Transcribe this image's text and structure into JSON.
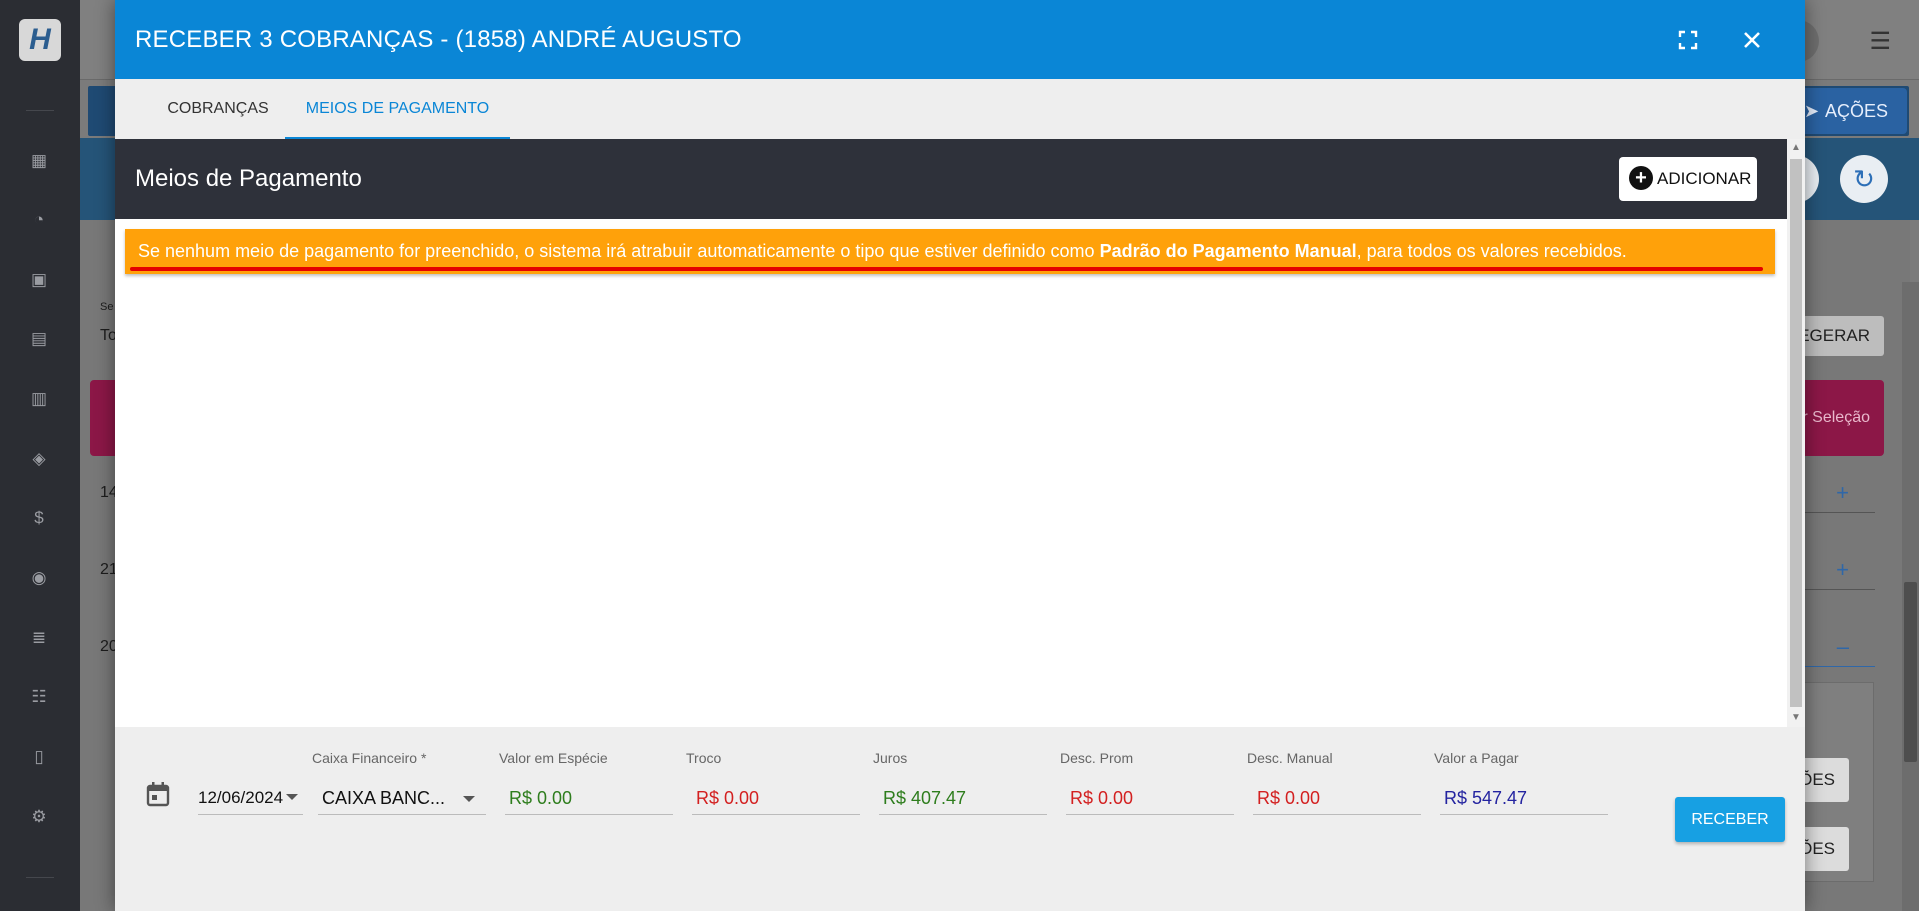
{
  "modal": {
    "title": "RECEBER 3 COBRANÇAS - (1858) ANDRÉ AUGUSTO",
    "tabs": [
      {
        "label": "COBRANÇAS"
      },
      {
        "label": "MEIOS DE PAGAMENTO"
      }
    ],
    "section_title": "Meios de Pagamento",
    "add_label": "ADICIONAR",
    "warning": {
      "before": "Se nenhum meio de pagamento for preenchido, o sistema irá atrabuir automaticamente o tipo que estiver definido como ",
      "bold": "Padrão do Pagamento Manual",
      "after": ", para todos os valores recebidos."
    },
    "footer": {
      "date": "12/06/2024",
      "caixa_label": "Caixa Financeiro *",
      "caixa_value": "CAIXA BANC...",
      "especie_label": "Valor em Espécie",
      "especie_value": "R$ 0.00",
      "troco_label": "Troco",
      "troco_value": "R$ 0.00",
      "juros_label": "Juros",
      "juros_value": "R$ 407.47",
      "desc_prom_label": "Desc. Prom",
      "desc_prom_value": "R$ 0.00",
      "desc_manual_label": "Desc. Manual",
      "desc_manual_value": "R$ 0.00",
      "pagar_label": "Valor a Pagar",
      "pagar_value": "R$ 547.47",
      "receber_label": "RECEBER"
    }
  },
  "background": {
    "acoes_label": "AÇÕES",
    "regerar_label": "EGERAR",
    "selecao_label": "r Seleção",
    "btn_label": "ÕES",
    "partial_texts": [
      "Se",
      "To",
      "14",
      "21",
      "20"
    ]
  },
  "colors": {
    "header_blue": "#0a86d6",
    "warning_orange": "#ffa10a",
    "section_dark": "#2e313a",
    "receber_blue": "#17a0e3"
  }
}
